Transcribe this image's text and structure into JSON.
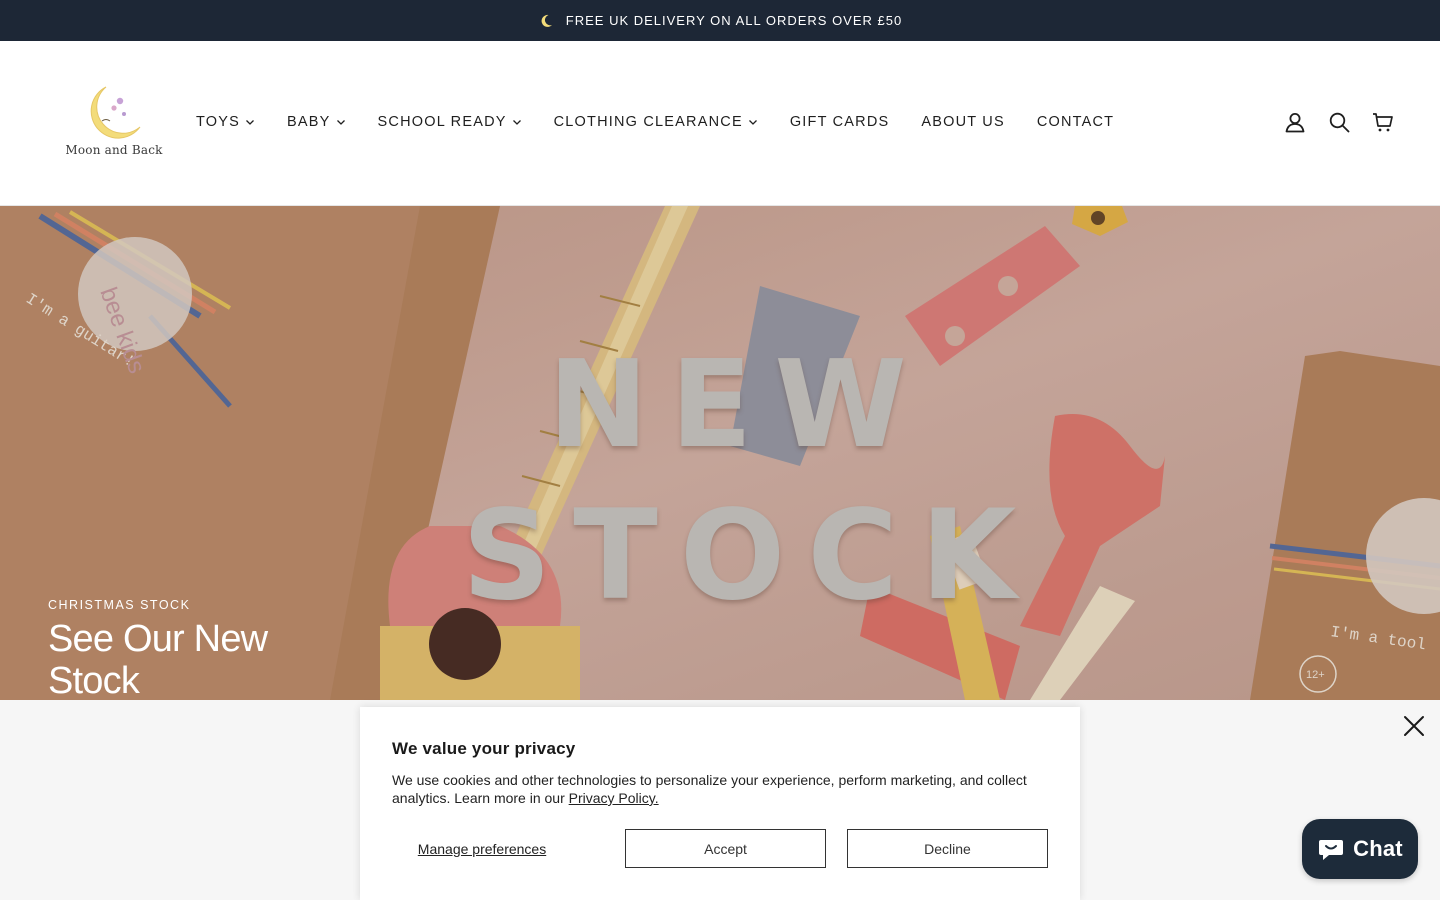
{
  "announcement": {
    "text": "FREE UK DELIVERY ON ALL ORDERS OVER £50",
    "icon": "moon-icon"
  },
  "brand": {
    "logo_text": "Moon and Back",
    "colors": {
      "moon": "#f3dc7a",
      "accent": "#1d2736"
    }
  },
  "nav": {
    "items": [
      {
        "label": "TOYS",
        "dropdown": true
      },
      {
        "label": "BABY",
        "dropdown": true
      },
      {
        "label": "SCHOOL READY",
        "dropdown": true
      },
      {
        "label": "CLOTHING CLEARANCE",
        "dropdown": true
      },
      {
        "label": "GIFT CARDS",
        "dropdown": false
      },
      {
        "label": "ABOUT US",
        "dropdown": false
      },
      {
        "label": "CONTACT",
        "dropdown": false
      }
    ]
  },
  "header_icons": [
    "account-icon",
    "search-icon",
    "cart-icon"
  ],
  "hero": {
    "eyebrow": "CHRISTMAS STOCK",
    "headline": "See Our New Stock",
    "overlay_line1": "NEW",
    "overlay_line2": "STOCK",
    "box_text_left": "I'm a guitar!",
    "box_text_right": "I'm a tool",
    "sticker_text": "bee kids",
    "age_badge": "12+"
  },
  "cookie_banner": {
    "title": "We value your privacy",
    "body": "We use cookies and other technologies to personalize your experience, perform marketing, and collect analytics. Learn more in our ",
    "link": "Privacy Policy.",
    "manage": "Manage preferences",
    "accept": "Accept",
    "decline": "Decline"
  },
  "chat": {
    "label": "Chat",
    "icon": "chat-bubble-icon",
    "color": "#1d2b3a"
  }
}
